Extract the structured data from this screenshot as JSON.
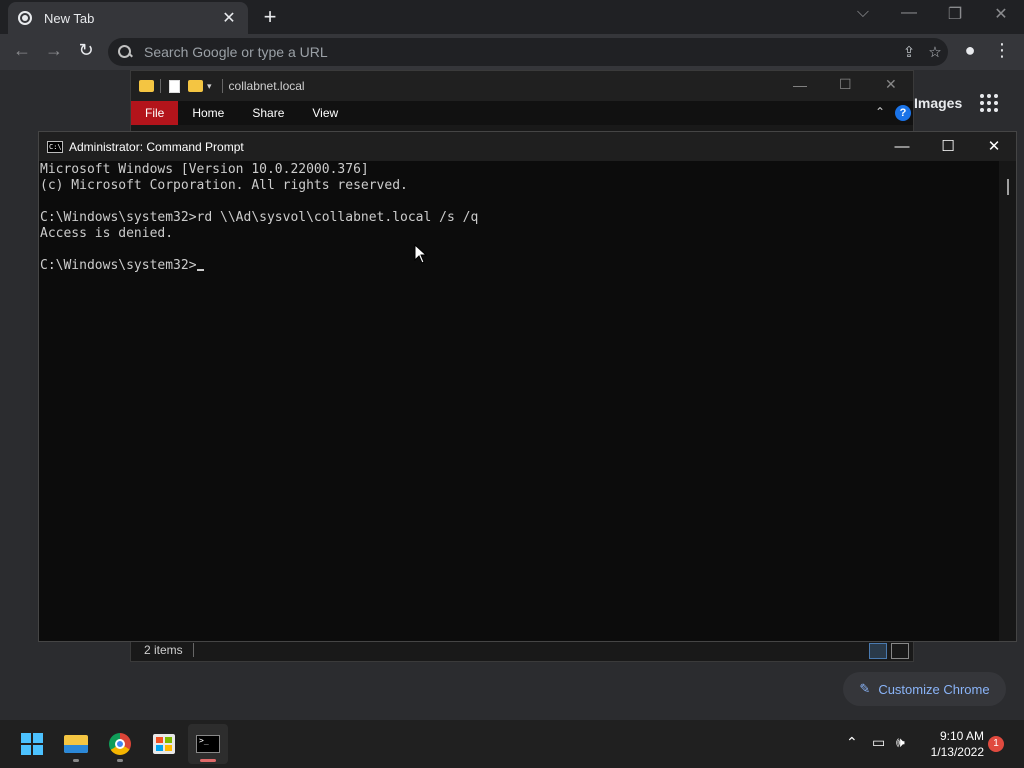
{
  "chrome": {
    "tab_title": "New Tab",
    "tab_close": "✕",
    "new_tab": "+",
    "omnibox_placeholder": "Search Google or type a URL",
    "images_link": "Images",
    "customize_label": "Customize Chrome"
  },
  "explorer": {
    "title": "collabnet.local",
    "ribbon_tabs": [
      "File",
      "Home",
      "Share",
      "View"
    ],
    "status": "2 items"
  },
  "cmd": {
    "title": "Administrator: Command Prompt",
    "lines": [
      "Microsoft Windows [Version 10.0.22000.376]",
      "(c) Microsoft Corporation. All rights reserved.",
      "",
      "C:\\Windows\\system32>rd \\\\Ad\\sysvol\\collabnet.local /s /q",
      "Access is denied.",
      "",
      "C:\\Windows\\system32>"
    ]
  },
  "taskbar": {
    "time": "9:10 AM",
    "date": "1/13/2022",
    "notification_count": "1"
  },
  "colors": {
    "accent_red": "#b3141b",
    "start_blue": "#4cc2ff",
    "link_blue": "#8ab4f8"
  }
}
